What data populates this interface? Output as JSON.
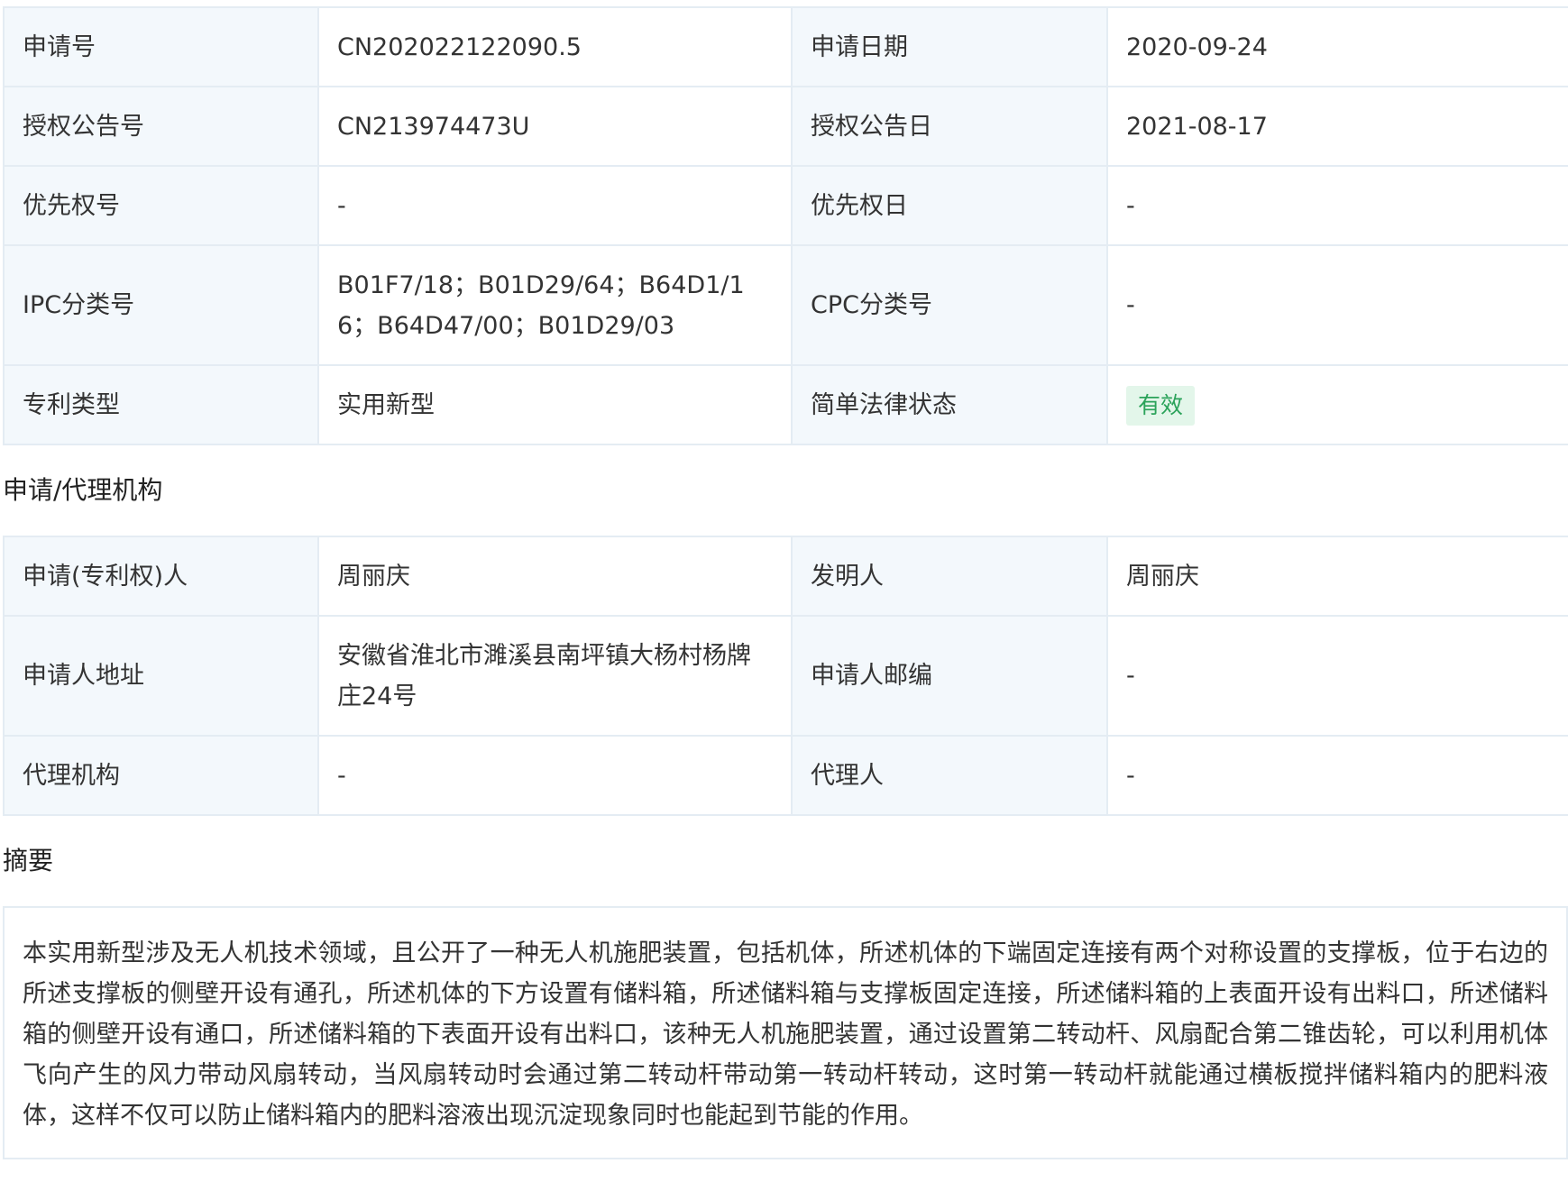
{
  "basic_info": {
    "rows": [
      {
        "label1": "申请号",
        "value1": "CN202022122090.5",
        "label2": "申请日期",
        "value2": "2020-09-24"
      },
      {
        "label1": "授权公告号",
        "value1": "CN213974473U",
        "label2": "授权公告日",
        "value2": "2021-08-17"
      },
      {
        "label1": "优先权号",
        "value1": "-",
        "label2": "优先权日",
        "value2": "-"
      },
      {
        "label1": "IPC分类号",
        "value1": "B01F7/18；B01D29/64；B64D1/16；B64D47/00；B01D29/03",
        "label2": "CPC分类号",
        "value2": "-"
      },
      {
        "label1": "专利类型",
        "value1": "实用新型",
        "label2": "简单法律状态",
        "value2": "有效"
      }
    ]
  },
  "agency": {
    "title": "申请/代理机构",
    "rows": [
      {
        "label1": "申请(专利权)人",
        "value1": "周丽庆",
        "label2": "发明人",
        "value2": "周丽庆"
      },
      {
        "label1": "申请人地址",
        "value1": "安徽省淮北市濉溪县南坪镇大杨村杨牌庄24号",
        "label2": "申请人邮编",
        "value2": "-"
      },
      {
        "label1": "代理机构",
        "value1": "-",
        "label2": "代理人",
        "value2": "-"
      }
    ]
  },
  "abstract": {
    "title": "摘要",
    "text": "本实用新型涉及无人机技术领域，且公开了一种无人机施肥装置，包括机体，所述机体的下端固定连接有两个对称设置的支撑板，位于右边的所述支撑板的侧壁开设有通孔，所述机体的下方设置有储料箱，所述储料箱与支撑板固定连接，所述储料箱的上表面开设有出料口，所述储料箱的侧壁开设有通口，所述储料箱的下表面开设有出料口，该种无人机施肥装置，通过设置第二转动杆、风扇配合第二锥齿轮，可以利用机体飞向产生的风力带动风扇转动，当风扇转动时会通过第二转动杆带动第一转动杆转动，这时第一转动杆就能通过横板搅拌储料箱内的肥料液体，这样不仅可以防止储料箱内的肥料溶液出现沉淀现象同时也能起到节能的作用。"
  },
  "colors": {
    "label_bg": "#f3f8fc",
    "border": "#e4ecf3",
    "status_badge_bg": "#e3f6ea",
    "status_badge_text": "#2ba35a"
  }
}
